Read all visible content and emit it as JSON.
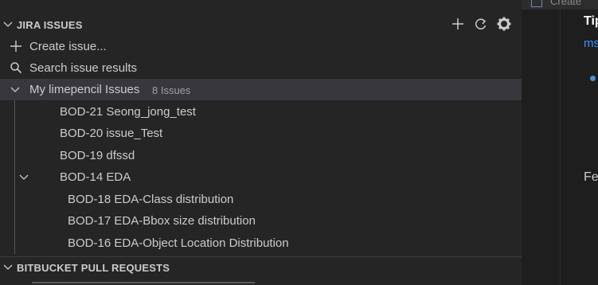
{
  "jira": {
    "title": "JIRA ISSUES",
    "actions": [
      {
        "icon": "plus-icon"
      },
      {
        "icon": "refresh-icon"
      },
      {
        "icon": "gear-icon"
      }
    ],
    "create_label": "Create issue...",
    "search_label": "Search issue results",
    "group": {
      "label": "My limepencil Issues",
      "count": "8 Issues"
    },
    "issues": [
      "BOD-21 Seong_jong_test",
      "BOD-20 issue_Test",
      "BOD-19 dfssd"
    ],
    "epic": {
      "label": "BOD-14 EDA",
      "children": [
        "BOD-18 EDA-Class distribution",
        "BOD-17 EDA-Bbox size distribution",
        "BOD-16 EDA-Object Location Distribution"
      ]
    }
  },
  "bitbucket": {
    "title": "BITBUCKET PULL REQUESTS"
  },
  "editor": {
    "tab_text": "Create",
    "tip": "Tip",
    "ms": "ms",
    "fe": "Fe"
  },
  "colors": {
    "sidebar_bg": "#252526",
    "selected_bg": "#37373d",
    "editor_bg": "#1e1e1e",
    "link": "#3794ff"
  }
}
